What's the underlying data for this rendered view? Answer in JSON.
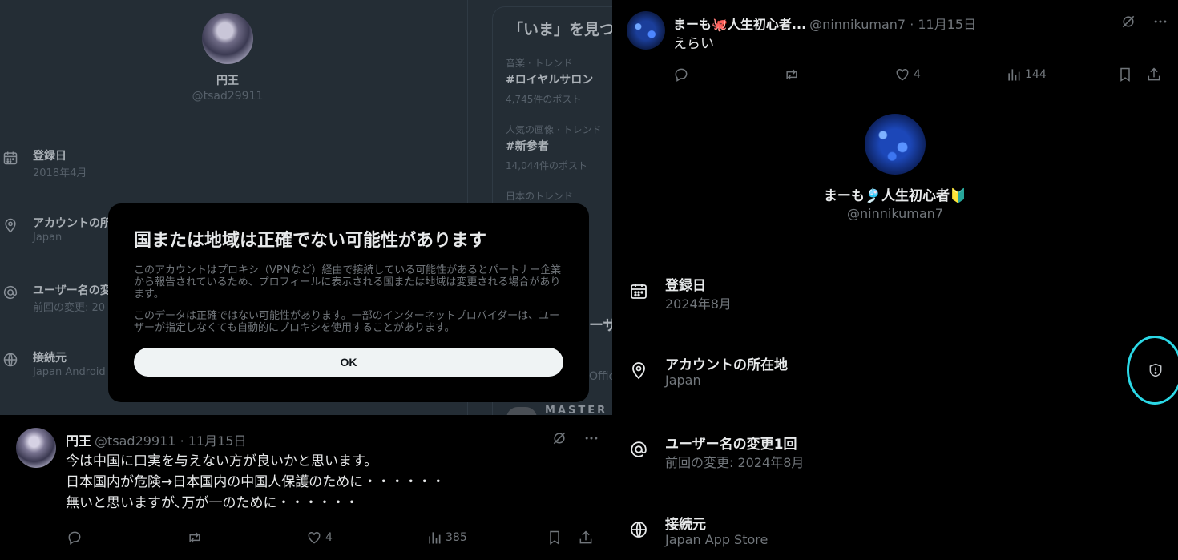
{
  "left_profile": {
    "name": "円王",
    "handle": "@tsad29911",
    "rows": [
      {
        "icon": "calendar-icon",
        "label": "登録日",
        "value": "2018年4月"
      },
      {
        "icon": "location-icon",
        "label": "アカウントの所",
        "value": "Japan"
      },
      {
        "icon": "at-icon",
        "label": "ユーザー名の変",
        "value": "前回の変更: 20"
      },
      {
        "icon": "globe-icon",
        "label": "接続元",
        "value": "Japan Android"
      }
    ]
  },
  "trends": {
    "title": "「いま」を見つ",
    "items": [
      {
        "category": "音楽 · トレンド",
        "tag": "#ロイヤルサロン",
        "count": "4,745件のポスト"
      },
      {
        "category": "人気の画像 · トレンド",
        "tag": "#新参者",
        "count": "14,044件のポスト"
      },
      {
        "category": "日本のトレンド",
        "tag": "",
        "count": ""
      }
    ],
    "fragment_heading": "ーザ",
    "fragment_text": "Offic",
    "fragment_master": "MASTER"
  },
  "modal": {
    "title": "国または地域は正確でない可能性があります",
    "paragraph1": "このアカウントはプロキシ（VPNなど）経由で接続している可能性があるとパートナー企業から報告されているため、プロフィールに表示される国または地域は変更される場合があります。",
    "paragraph2": "このデータは正確ではない可能性があります。一部のインターネットプロバイダーは、ユーザーが指定しなくても自動的にプロキシを使用することがあります。",
    "ok_label": "OK"
  },
  "tweet_left": {
    "name": "円王",
    "meta": "@tsad29911 · 11月15日",
    "lines": [
      "今は中国に口実を与えない方が良いかと思います。",
      "日本国内が危険→日本国内の中国人保護のために・・・・・・",
      "無いと思いますが､万が一のために・・・・・・"
    ],
    "likes": "4",
    "views": "385"
  },
  "tweet_right": {
    "name": "まーも🐙人生初心者...",
    "meta": "@ninnikuman7 · 11月15日",
    "text": "えらい",
    "likes": "4",
    "views": "144"
  },
  "right_profile": {
    "name": "まーも🎐人生初心者🔰",
    "handle": "@ninnikuman7",
    "rows": [
      {
        "icon": "calendar-icon",
        "label": "登録日",
        "value": "2024年8月"
      },
      {
        "icon": "location-icon",
        "label": "アカウントの所在地",
        "value": "Japan"
      },
      {
        "icon": "at-icon",
        "label": "ユーザー名の変更1回",
        "value": "前回の変更: 2024年8月"
      },
      {
        "icon": "globe-icon",
        "label": "接続元",
        "value": "Japan App Store"
      }
    ]
  },
  "colors": {
    "highlight_circle": "#2bd8e6",
    "dim_overlay": "#242d35"
  }
}
